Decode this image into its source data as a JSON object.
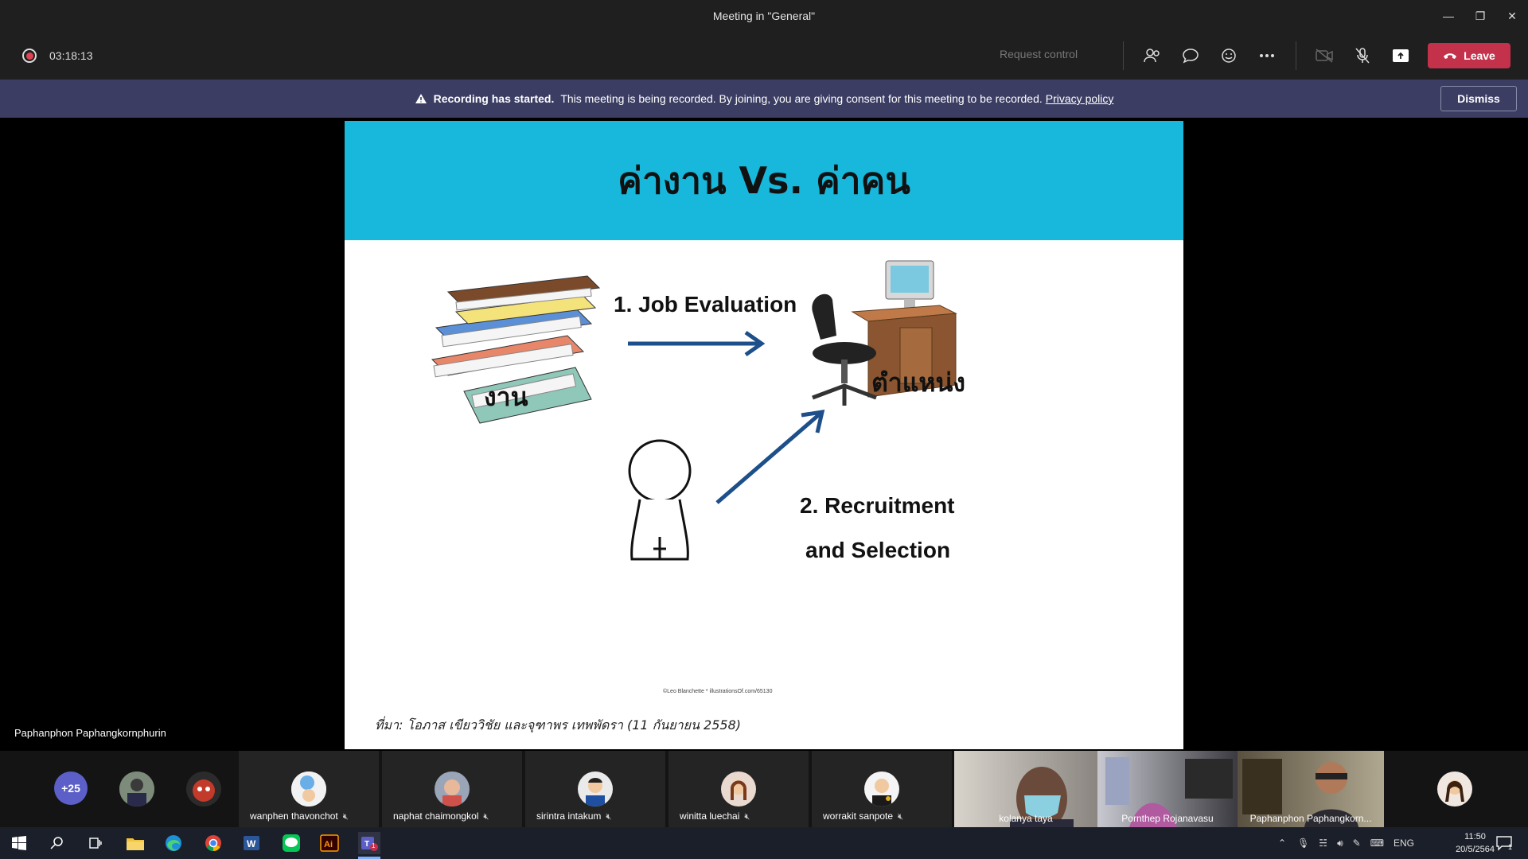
{
  "window": {
    "title": "Meeting in \"General\""
  },
  "toolbar": {
    "timer": "03:18:13",
    "request_control": "Request control",
    "leave_label": "Leave",
    "icons": [
      "participants-icon",
      "chat-icon",
      "reactions-icon",
      "more-icon",
      "camera-off-icon",
      "mic-off-icon",
      "share-icon",
      "phone-icon"
    ]
  },
  "banner": {
    "bold": "Recording has started.",
    "text": "This meeting is being recorded. By joining, you are giving consent for this meeting to be recorded.",
    "link": "Privacy policy",
    "dismiss": "Dismiss"
  },
  "slide": {
    "title": "ค่างาน Vs. ค่าคน",
    "arrow1_label": "1. Job Evaluation",
    "left_label": "งาน",
    "right_label": "ตำแหน่ง",
    "arrow2_line1": "2. Recruitment",
    "arrow2_line2": "and Selection",
    "credit": "©Leo Blanchette  *  illustrationsOf.com/65130",
    "footnote": "ที่มา: โอภาส เขียววิชัย และจุฑาพร เทพพัดรา (11 กันยายน 2558)",
    "colors": {
      "header": "#17b8dc",
      "arrow": "#1d4f8a"
    }
  },
  "presenter": {
    "name": "Paphanphon Paphangkornphurin"
  },
  "participants": {
    "overflow": "+25",
    "tiles": [
      {
        "name": "wanphen thavonchot"
      },
      {
        "name": "naphat chaimongkol"
      },
      {
        "name": "sirintra intakum"
      },
      {
        "name": "winitta luechai"
      },
      {
        "name": "worrakit sanpote"
      }
    ],
    "videos": [
      {
        "name": "kolanya taya"
      },
      {
        "name": "Pornthep Rojanavasu"
      },
      {
        "name": "Paphanphon Paphangkorn..."
      }
    ]
  },
  "taskbar": {
    "lang": "ENG",
    "time": "11:50",
    "date": "20/5/2564",
    "notif_count": "1",
    "teams_badge": "1"
  }
}
